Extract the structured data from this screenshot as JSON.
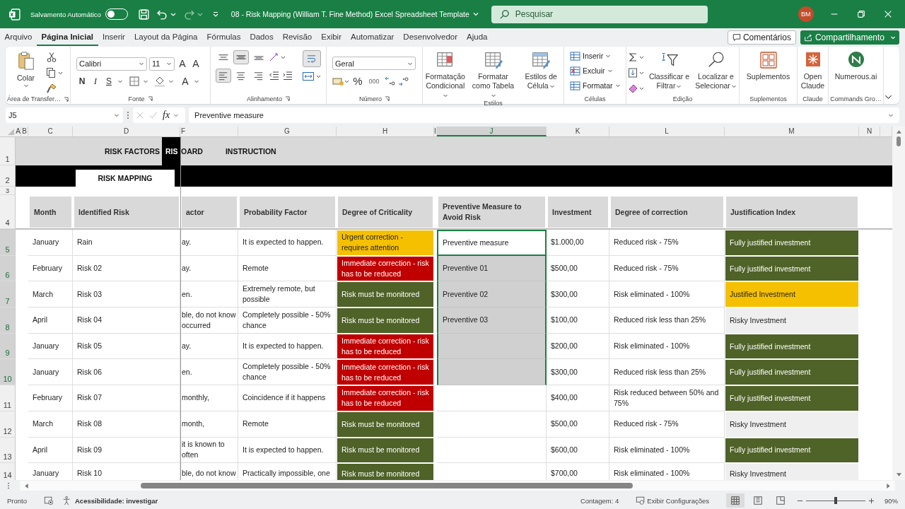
{
  "title_bar": {
    "autosave_label": "Salvamento Automático",
    "autosave_on": false,
    "document_title": "08 - Risk Mapping (William T. Fine Method) Excel Spreadsheet Template",
    "search": {
      "placeholder": "Pesquisar"
    },
    "avatar": "BM"
  },
  "menu": {
    "tabs": [
      {
        "label": "Arquivo",
        "selected": false
      },
      {
        "label": "Página Inicial",
        "selected": true
      },
      {
        "label": "Inserir",
        "selected": false
      },
      {
        "label": "Layout da Página",
        "selected": false
      },
      {
        "label": "Fórmulas",
        "selected": false
      },
      {
        "label": "Dados",
        "selected": false
      },
      {
        "label": "Revisão",
        "selected": false
      },
      {
        "label": "Exibir",
        "selected": false
      },
      {
        "label": "Automatizar",
        "selected": false
      },
      {
        "label": "Desenvolvedor",
        "selected": false
      },
      {
        "label": "Ajuda",
        "selected": false
      }
    ],
    "comments": "Comentários",
    "share": "Compartilhamento"
  },
  "ribbon": {
    "clipboard": {
      "paste": "Colar",
      "label": "Área de Transfer…"
    },
    "font": {
      "name": "Calibri",
      "size": "11",
      "grow": "A",
      "shrink": "A",
      "bold": "N",
      "italic": "I",
      "underline": "S",
      "color_letter": "A",
      "label": "Fonte"
    },
    "alignment": {
      "vertical": [
        {
          "selected": false
        },
        {
          "selected": true
        },
        {
          "selected": false
        }
      ],
      "horizontal": [
        {
          "selected": true
        },
        {
          "selected": false
        },
        {
          "selected": false
        }
      ],
      "wrap_text_on": true,
      "label": "Alinhamento"
    },
    "number": {
      "format": "Geral",
      "percent": "%",
      "thousands": "000",
      "label": "Número"
    },
    "styles": {
      "buttons": [
        "Formatação Condicional",
        "Formatar como Tabela",
        "Estilos de Célula"
      ],
      "label": "Estilos"
    },
    "cells": {
      "buttons": [
        "Inserir",
        "Excluir",
        "Formatar"
      ],
      "label": "Células"
    },
    "editing": {
      "buttons": [
        "Classificar e Filtrar",
        "Localizar e Selecionar"
      ],
      "label": "Edição"
    },
    "addins": {
      "button": "Suplementos",
      "label": "Suplementos"
    },
    "claude": {
      "button": "Open Claude",
      "label": "Claude"
    },
    "commands": {
      "button": "Numerous.ai",
      "label": "Commands Gro…"
    }
  },
  "formula_bar": {
    "name_box": "J5",
    "function_label": "fx",
    "formula": "Preventive measure"
  },
  "sheet": {
    "columns": [
      {
        "label": "A",
        "selected": false
      },
      {
        "label": "B",
        "selected": false
      },
      {
        "label": "C",
        "selected": false
      },
      {
        "label": "D",
        "selected": false
      },
      {
        "label": "F",
        "selected": false
      },
      {
        "label": "G",
        "selected": false
      },
      {
        "label": "H",
        "selected": false
      },
      {
        "label": "I",
        "selected": false
      },
      {
        "label": "J",
        "selected": true
      },
      {
        "label": "K",
        "selected": false
      },
      {
        "label": "L",
        "selected": false
      },
      {
        "label": "M",
        "selected": false
      },
      {
        "label": "N",
        "selected": false
      }
    ],
    "top_rows": [
      "1",
      "2",
      "3",
      "4"
    ],
    "nav": [
      {
        "label": "RISK FACTORS",
        "dark": false
      },
      {
        "label": "RIS",
        "dark": true
      },
      {
        "label": "OARD",
        "dark": false
      },
      {
        "label": "INSTRUCTION",
        "dark": false
      }
    ],
    "page_tab": "RISK MAPPING",
    "headers": [
      "Month",
      "Identified Risk",
      "actor",
      "Probability Factor",
      "Degree of Criticality",
      "Preventive Measure to Avoid Risk",
      "Investment",
      "Degree of correction",
      "Justification Index"
    ],
    "rows": [
      {
        "row": "5",
        "month": "January",
        "risk": "Rain",
        "factor": "ay.",
        "probability": "It is expected to happen.",
        "criticality": {
          "text": "Urgent correction - requires attention",
          "color": "#f5c000"
        },
        "preventive": {
          "text": "Preventive measure",
          "selected": true,
          "active": true
        },
        "investment": "$1.000,00",
        "correction": "Reduced risk - 75%",
        "justification": {
          "text": "Fully justified investment",
          "color": "#4f6228"
        }
      },
      {
        "row": "6",
        "month": "February",
        "risk": "Risk 02",
        "factor": "ay.",
        "probability": "Remote",
        "criticality": {
          "text": "Immediate correction - risk has to be reduced",
          "color": "#c00000"
        },
        "preventive": {
          "text": "Preventive 01",
          "selected": true,
          "active": false
        },
        "investment": "$500,00",
        "correction": "Reduced risk - 75%",
        "justification": {
          "text": "Fully justified investment",
          "color": "#4f6228"
        }
      },
      {
        "row": "7",
        "month": "March",
        "risk": "Risk 03",
        "factor": "en.",
        "probability": "Extremely remote, but possible",
        "criticality": {
          "text": "Risk must be monitored",
          "color": "#4f6228"
        },
        "preventive": {
          "text": "Preventive 02",
          "selected": true,
          "active": false
        },
        "investment": "$300,00",
        "correction": "Risk eliminated - 100%",
        "justification": {
          "text": "Justified Investment",
          "color": "#f5c000"
        }
      },
      {
        "row": "8",
        "month": "April",
        "risk": "Risk 04",
        "factor": "ble, do not know occurred",
        "probability": "Completely possible - 50% chance",
        "criticality": {
          "text": "Risk must be monitored",
          "color": "#4f6228"
        },
        "preventive": {
          "text": "Preventive 03",
          "selected": true,
          "active": false
        },
        "investment": "$100,00",
        "correction": "Reduced risk less than 25%",
        "justification": {
          "text": "Risky Investment",
          "color": "#efefef"
        }
      },
      {
        "row": "9",
        "month": "January",
        "risk": "Risk 05",
        "factor": "ay.",
        "probability": "It is expected to happen.",
        "criticality": {
          "text": "Immediate correction - risk has to be reduced",
          "color": "#c00000"
        },
        "preventive": {
          "selected": true,
          "active": false
        },
        "investment": "$200,00",
        "correction": "Risk eliminated - 100%",
        "justification": {
          "text": "Fully justified investment",
          "color": "#4f6228"
        }
      },
      {
        "row": "10",
        "month": "January",
        "risk": "Risk 06",
        "factor": "en.",
        "probability": "Completely possible - 50% chance",
        "criticality": {
          "text": "Immediate correction - risk has to be reduced",
          "color": "#c00000"
        },
        "preventive": {
          "selected": true,
          "active": false
        },
        "investment": "$300,00",
        "correction": "Reduced risk less than 25%",
        "justification": {
          "text": "Fully justified investment",
          "color": "#4f6228"
        }
      },
      {
        "row": "11",
        "month": "February",
        "risk": "Risk 07",
        "factor": "monthly,",
        "probability": "Coincidence if it happens",
        "criticality": {
          "text": "Immediate correction - risk has to be reduced",
          "color": "#c00000"
        },
        "preventive": {
          "selected": false,
          "active": false
        },
        "investment": "$400,00",
        "correction": "Risk reduced between 50% and 75%",
        "justification": {
          "text": "Fully justified investment",
          "color": "#4f6228"
        }
      },
      {
        "row": "12",
        "month": "March",
        "risk": "Risk 08",
        "factor": "month,",
        "probability": "Remote",
        "criticality": {
          "text": "Risk must be monitored",
          "color": "#4f6228"
        },
        "preventive": {
          "selected": false,
          "active": false
        },
        "investment": "$500,00",
        "correction": "Reduced risk - 75%",
        "justification": {
          "text": "Risky Investment",
          "color": "#efefef"
        }
      },
      {
        "row": "13",
        "month": "April",
        "risk": "Risk 09",
        "factor": "it is known to often",
        "probability": "It is expected to happen.",
        "criticality": {
          "text": "Risk must be monitored",
          "color": "#4f6228"
        },
        "preventive": {
          "selected": false,
          "active": false
        },
        "investment": "$600,00",
        "correction": "Risk eliminated - 100%",
        "justification": {
          "text": "Fully justified investment",
          "color": "#4f6228"
        }
      },
      {
        "row": "14",
        "month": "January",
        "risk": "Risk 10",
        "factor": "ble, do not know",
        "probability": "Practically impossible, one",
        "criticality": {
          "text": "Risk must be monitored",
          "color": "#4f6228"
        },
        "preventive": {
          "selected": false,
          "active": false
        },
        "investment": "$700,00",
        "correction": "Risk eliminated - 100%",
        "justification": {
          "text": "Risky Investment",
          "color": "#efefef"
        }
      }
    ]
  },
  "status_bar": {
    "ready": "Pronto",
    "accessibility": "Acessibilidade: investigar",
    "count": "Contagem: 4",
    "display_settings": "Exibir Configurações",
    "views": [
      {
        "selected": true
      },
      {
        "selected": false
      },
      {
        "selected": false
      }
    ],
    "zoom": {
      "level": 0.5,
      "reading": "90%"
    }
  }
}
